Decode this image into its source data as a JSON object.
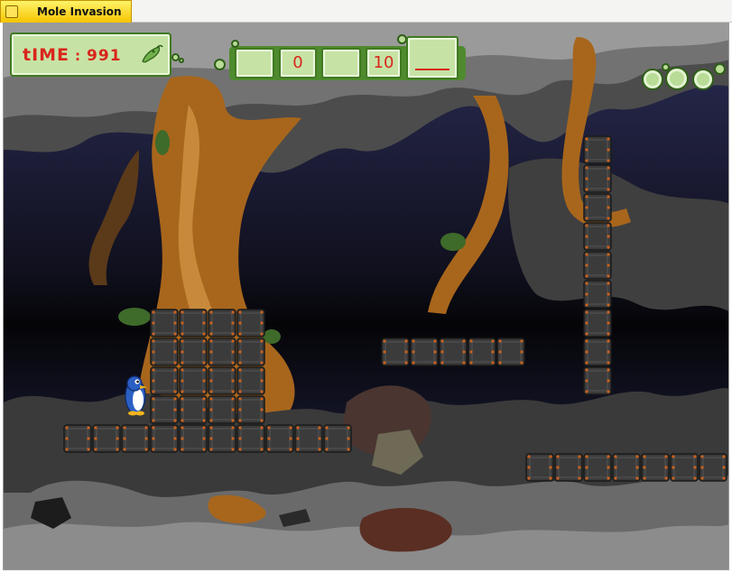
{
  "window": {
    "title": "Mole Invasion"
  },
  "hud": {
    "time_label": "tIME",
    "time_separator": ":",
    "time_value": "991",
    "slots": [
      "",
      "0",
      "",
      "10",
      ""
    ]
  },
  "colors": {
    "hud_fill": "#c6e3a5",
    "hud_border": "#3f7a21",
    "hud_text": "#d9261c",
    "cave_sky": "#23244a",
    "rock": "#555555",
    "tree_trunk": "#a8661c",
    "crate": "#3b3b3b",
    "crate_bolt": "#c9621e",
    "penguin": "#2b5fc4"
  },
  "icons": {
    "window_icon": "square-icon",
    "time_icon": "chili-pepper-icon",
    "menu": "bubble-buttons-icon"
  },
  "scene": {
    "player": "penguin",
    "blocks": "metal-crate"
  }
}
